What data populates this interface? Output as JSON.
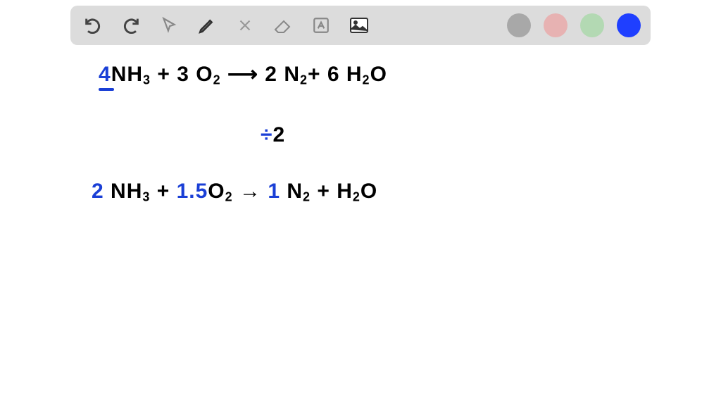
{
  "toolbar": {
    "icons": {
      "undo": "undo-icon",
      "redo": "redo-icon",
      "pointer": "pointer-icon",
      "pencil": "pencil-icon",
      "tools": "tools-icon",
      "eraser": "eraser-icon",
      "text": "text-icon",
      "image": "image-icon"
    },
    "colors": {
      "gray": "#a8a8a8",
      "pink": "#e7b2b2",
      "green": "#b3d9b3",
      "blue": "#1f3fff"
    }
  },
  "line1": {
    "coef1": "4",
    "nh3": "NH",
    "nh3_sub": "3",
    "plus1": " + 3 O",
    "o2_sub": "2",
    "arrow": " ⟶ ",
    "coef2": "2 N",
    "n2_sub": "2",
    "plus2": "+ ",
    "coef3": "6 H",
    "h2_sub": "2",
    "o": "O"
  },
  "line2": {
    "div": "÷",
    "num": "2"
  },
  "line3": {
    "coef1": "2",
    "nh3": " NH",
    "nh3_sub": "3",
    "plus1": " + ",
    "coef15": "1.5",
    "o2": "O",
    "o2_sub": "2",
    "arrow": "  →  ",
    "coef2": "1",
    "n2": " N",
    "n2_sub": "2",
    "plus2": " +   H",
    "h2_sub": "2",
    "o": "O"
  }
}
